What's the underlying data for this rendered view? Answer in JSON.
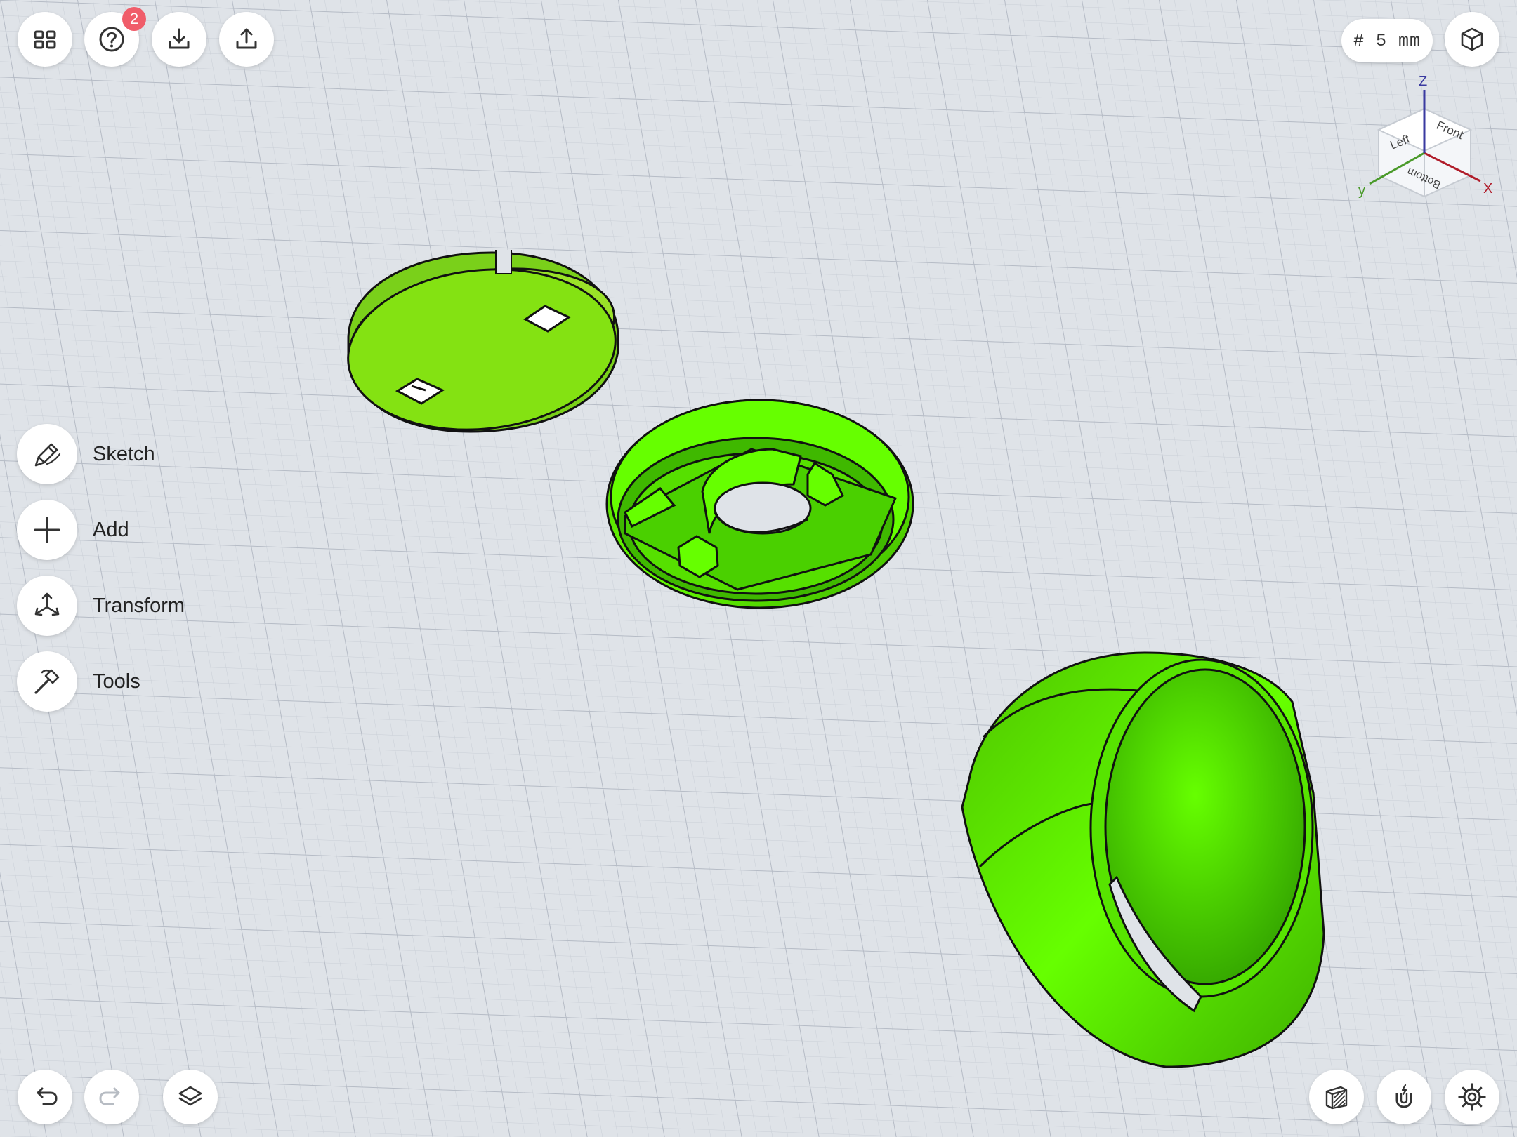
{
  "toolbar": {
    "grid_label": "# 5 mm",
    "help_badge": "2"
  },
  "sidebar": {
    "items": [
      {
        "label": "Sketch",
        "icon": "pen-icon"
      },
      {
        "label": "Add",
        "icon": "plus-icon"
      },
      {
        "label": "Transform",
        "icon": "transform-icon"
      },
      {
        "label": "Tools",
        "icon": "hammer-icon"
      }
    ]
  },
  "view_cube": {
    "faces": {
      "left": "Left",
      "front": "Front",
      "bottom": "Bottom"
    },
    "axes": {
      "x": "X",
      "y": "y",
      "z": "Z"
    }
  },
  "colors": {
    "model_green": "#66ff00",
    "grid_bg": "#dfe3e8",
    "badge_red": "#f05d6a",
    "axis_x": "#b01c2a",
    "axis_y": "#4a9a2a",
    "axis_z": "#3a3aa0"
  }
}
